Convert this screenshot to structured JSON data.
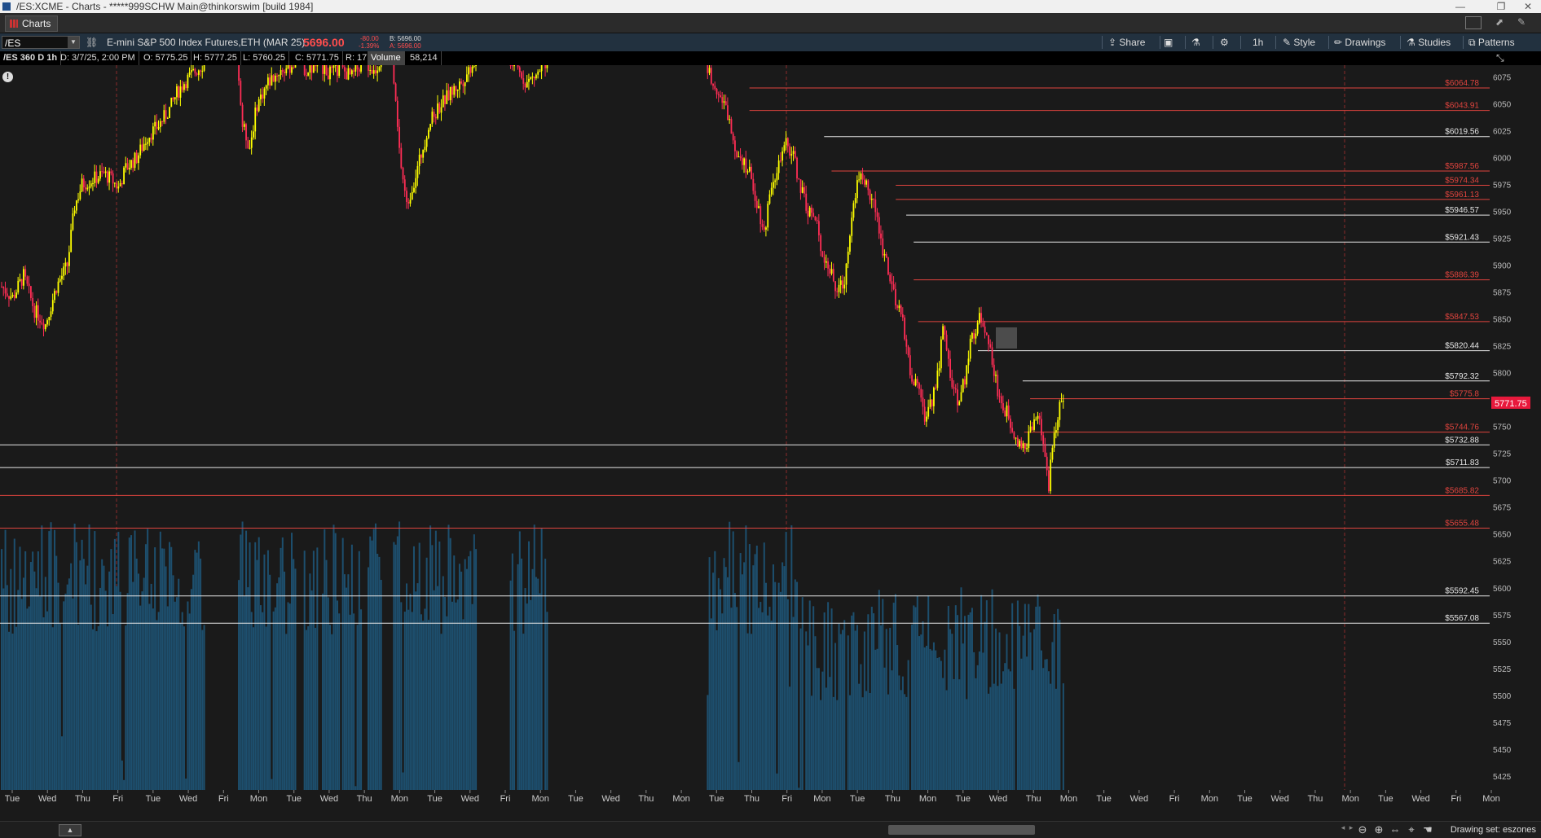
{
  "window": {
    "title": "/ES:XCME - Charts - *****999SCHW Main@thinkorswim [build 1984]",
    "controls": [
      "—",
      "❐",
      "✕"
    ]
  },
  "tabs": [
    {
      "label": "Charts"
    }
  ],
  "toolbar": {
    "symbol": "/ES",
    "description": "E-mini S&P 500 Index Futures,ETH (MAR 25)",
    "last_price": "5696.00",
    "net_change": "-80.00",
    "pct_change": "-1.39%",
    "bid": "B: 5696.00",
    "ask": "A: 5696.00",
    "share": "Share",
    "timeframe": "1h",
    "style": "Style",
    "drawings": "Drawings",
    "studies": "Studies",
    "patterns": "Patterns"
  },
  "infobar": {
    "chart_label": "/ES 360 D 1h",
    "date": "D: 3/7/25, 2:00 PM",
    "open": "O: 5775.25",
    "high": "H: 5777.25",
    "low": "L: 5760.25",
    "close": "C: 5771.75",
    "range": "R: 17",
    "volume_label": "Volume",
    "volume_value": "58,214"
  },
  "status": {
    "drawing_set": "Drawing set: eszones"
  },
  "colors": {
    "up_candle": "#ffff00",
    "down_candle": "#ff2d55",
    "volume": "#1d4f6e",
    "zone_red": "#e0443e",
    "zone_white": "#e6e6e6",
    "current_price_bg": "#e8193c"
  },
  "chart_data": {
    "type": "candlestick",
    "y_axis": {
      "min": 5412,
      "max": 6086,
      "ticks": [
        6075,
        6050,
        6025,
        6000,
        5975,
        5950,
        5925,
        5900,
        5875,
        5850,
        5825,
        5800,
        5775,
        5750,
        5725,
        5700,
        5675,
        5650,
        5625,
        5600,
        5575,
        5550,
        5525,
        5500,
        5475,
        5450,
        5425
      ]
    },
    "x_tick_labels": [
      "Tue",
      "Wed",
      "Thu",
      "Fri",
      "Tue",
      "Wed",
      "Fri",
      "Mon",
      "Tue",
      "Wed",
      "Thu",
      "Mon",
      "Tue",
      "Wed",
      "Fri",
      "Mon",
      "Tue",
      "Wed",
      "Thu",
      "Mon",
      "Tue",
      "Thu",
      "Fri",
      "Mon",
      "Tue",
      "Thu",
      "Mon",
      "Tue",
      "Wed",
      "Thu",
      "Mon",
      "Tue",
      "Wed",
      "Fri",
      "Mon",
      "Tue",
      "Wed",
      "Thu",
      "Mon",
      "Tue",
      "Wed",
      "Fri",
      "Mon"
    ],
    "current_price": "5771.75",
    "zones": [
      {
        "price": 6064.78,
        "label": "$6064.78",
        "color": "red",
        "from": 0.502
      },
      {
        "price": 6043.91,
        "label": "$6043.91",
        "color": "red",
        "from": 0.502
      },
      {
        "price": 6019.56,
        "label": "$6019.56",
        "color": "white",
        "from": 0.552
      },
      {
        "price": 5987.56,
        "label": "$5987.56",
        "color": "red",
        "from": 0.557
      },
      {
        "price": 5974.34,
        "label": "$5974.34",
        "color": "red",
        "from": 0.6
      },
      {
        "price": 5961.13,
        "label": "$5961.13",
        "color": "red",
        "from": 0.6
      },
      {
        "price": 5946.57,
        "label": "$5946.57",
        "color": "white",
        "from": 0.607
      },
      {
        "price": 5921.43,
        "label": "$5921.43",
        "color": "white",
        "from": 0.612
      },
      {
        "price": 5886.39,
        "label": "$5886.39",
        "color": "red",
        "from": 0.612
      },
      {
        "price": 5847.53,
        "label": "$5847.53",
        "color": "red",
        "from": 0.615
      },
      {
        "price": 5820.44,
        "label": "$5820.44",
        "color": "white",
        "from": 0.655
      },
      {
        "price": 5792.32,
        "label": "$5792.32",
        "color": "white",
        "from": 0.685
      },
      {
        "price": 5775.8,
        "label": "$5775.8",
        "color": "red",
        "from": 0.69
      },
      {
        "price": 5744.76,
        "label": "$5744.76",
        "color": "red",
        "from": 0.686
      },
      {
        "price": 5732.88,
        "label": "$5732.88",
        "color": "white",
        "from": 0
      },
      {
        "price": 5711.83,
        "label": "$5711.83",
        "color": "white",
        "from": 0
      },
      {
        "price": 5685.82,
        "label": "$5685.82",
        "color": "red",
        "from": 0
      },
      {
        "price": 5655.48,
        "label": "$5655.48",
        "color": "red",
        "from": 0
      },
      {
        "price": 5592.45,
        "label": "$5592.45",
        "color": "white",
        "from": 0
      },
      {
        "price": 5567.08,
        "label": "$5567.08",
        "color": "white",
        "from": 0
      }
    ],
    "anchors": [
      [
        0,
        5880
      ],
      [
        6,
        5870
      ],
      [
        12,
        5890
      ],
      [
        18,
        5858
      ],
      [
        24,
        5845
      ],
      [
        30,
        5880
      ],
      [
        36,
        5900
      ],
      [
        40,
        5955
      ],
      [
        44,
        5975
      ],
      [
        50,
        5980
      ],
      [
        56,
        5985
      ],
      [
        60,
        5980
      ],
      [
        64,
        5972
      ],
      [
        68,
        5990
      ],
      [
        74,
        6000
      ],
      [
        80,
        6020
      ],
      [
        86,
        6030
      ],
      [
        92,
        6045
      ],
      [
        96,
        6060
      ],
      [
        100,
        6070
      ],
      [
        106,
        6080
      ],
      [
        112,
        6090
      ],
      [
        118,
        6100
      ],
      [
        124,
        6110
      ],
      [
        128,
        6115
      ],
      [
        132,
        6030
      ],
      [
        136,
        6010
      ],
      [
        140,
        6050
      ],
      [
        146,
        6070
      ],
      [
        152,
        6080
      ],
      [
        158,
        6085
      ],
      [
        162,
        6090
      ],
      [
        168,
        6080
      ],
      [
        174,
        6088
      ],
      [
        180,
        6078
      ],
      [
        186,
        6082
      ],
      [
        192,
        6075
      ],
      [
        198,
        6090
      ],
      [
        204,
        6080
      ],
      [
        210,
        6098
      ],
      [
        214,
        6090
      ],
      [
        218,
        6005
      ],
      [
        222,
        5955
      ],
      [
        228,
        5990
      ],
      [
        234,
        6030
      ],
      [
        240,
        6048
      ],
      [
        246,
        6060
      ],
      [
        252,
        6070
      ],
      [
        258,
        6088
      ],
      [
        264,
        6095
      ],
      [
        270,
        6100
      ],
      [
        276,
        6090
      ],
      [
        282,
        6082
      ],
      [
        288,
        6070
      ],
      [
        294,
        6078
      ],
      [
        300,
        6095
      ],
      [
        306,
        6100
      ],
      [
        312,
        6108
      ],
      [
        318,
        6110
      ],
      [
        324,
        6100
      ],
      [
        330,
        6092
      ],
      [
        336,
        6100
      ],
      [
        342,
        6112
      ],
      [
        346,
        6120
      ],
      [
        350,
        6150
      ],
      [
        354,
        6160
      ],
      [
        358,
        6160
      ],
      [
        364,
        6140
      ],
      [
        370,
        6130
      ],
      [
        376,
        6110
      ],
      [
        382,
        6100
      ],
      [
        386,
        6085
      ],
      [
        392,
        6065
      ],
      [
        398,
        6040
      ],
      [
        402,
        6010
      ],
      [
        406,
        6000
      ],
      [
        410,
        5985
      ],
      [
        414,
        5960
      ],
      [
        418,
        5930
      ],
      [
        422,
        5978
      ],
      [
        426,
        5992
      ],
      [
        430,
        6012
      ],
      [
        434,
        6002
      ],
      [
        438,
        5972
      ],
      [
        442,
        5952
      ],
      [
        446,
        5942
      ],
      [
        450,
        5912
      ],
      [
        454,
        5895
      ],
      [
        458,
        5875
      ],
      [
        462,
        5885
      ],
      [
        466,
        5950
      ],
      [
        470,
        5985
      ],
      [
        474,
        5975
      ],
      [
        478,
        5958
      ],
      [
        482,
        5922
      ],
      [
        486,
        5898
      ],
      [
        490,
        5862
      ],
      [
        494,
        5850
      ],
      [
        498,
        5800
      ],
      [
        502,
        5785
      ],
      [
        506,
        5760
      ],
      [
        510,
        5775
      ],
      [
        514,
        5810
      ],
      [
        516,
        5840
      ],
      [
        520,
        5800
      ],
      [
        524,
        5770
      ],
      [
        528,
        5795
      ],
      [
        532,
        5835
      ],
      [
        536,
        5850
      ],
      [
        540,
        5840
      ],
      [
        544,
        5800
      ],
      [
        548,
        5770
      ],
      [
        552,
        5760
      ],
      [
        556,
        5740
      ],
      [
        560,
        5728
      ],
      [
        564,
        5745
      ],
      [
        568,
        5760
      ],
      [
        572,
        5725
      ],
      [
        574,
        5690
      ],
      [
        576,
        5735
      ],
      [
        580,
        5770
      ],
      [
        582,
        5772
      ]
    ],
    "volume_range": [
      0,
      300000
    ]
  }
}
